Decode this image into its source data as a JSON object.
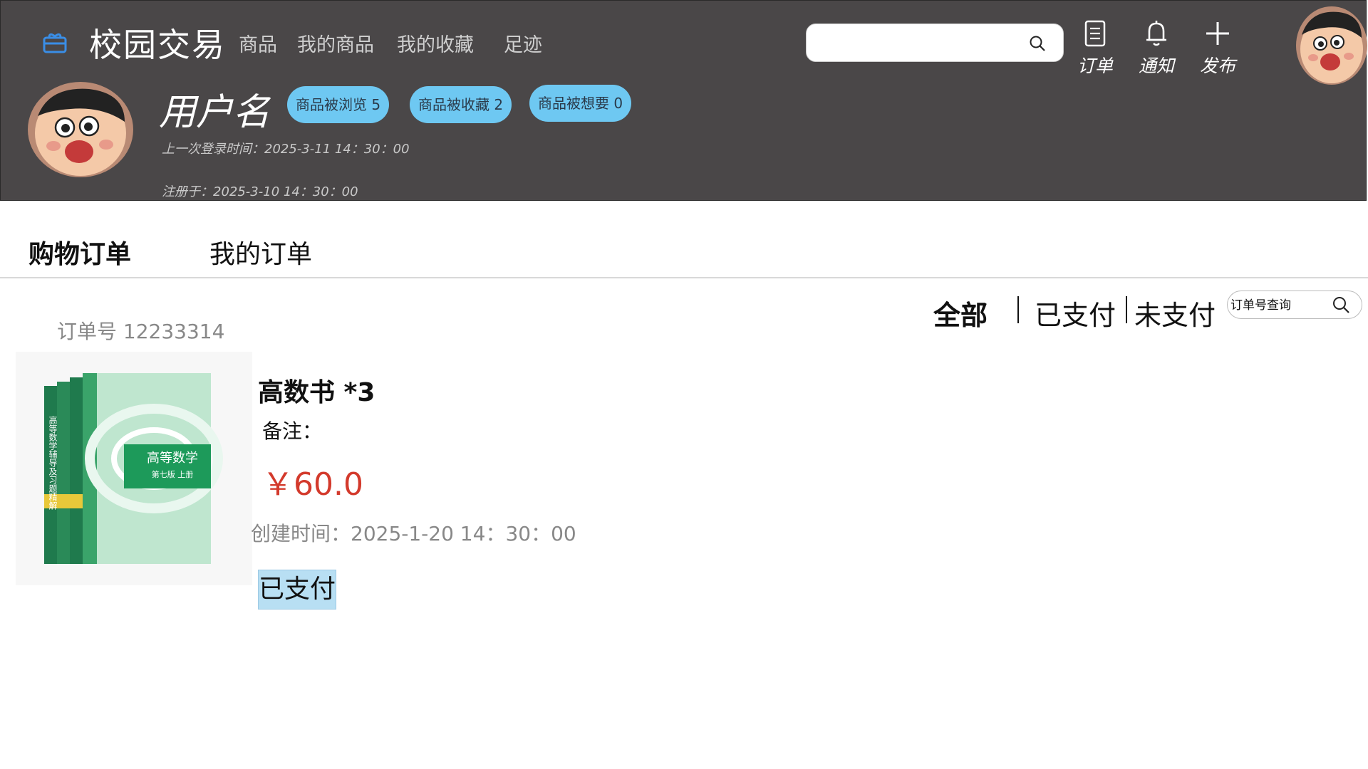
{
  "header": {
    "brand": "校园交易",
    "nav": [
      "商品",
      "我的商品",
      "我的收藏",
      "足迹"
    ],
    "search": {
      "value": "",
      "placeholder": ""
    },
    "actions": {
      "orders": "订单",
      "notify": "通知",
      "publish": "发布"
    }
  },
  "profile": {
    "username": "用户名",
    "badges": [
      "商品被浏览 5",
      "商品被收藏 2",
      "商品被想要 0"
    ],
    "last_login": "上一次登录时间：2025-3-11  14：30：00",
    "registered": "注册于：2025-3-10 14：30：00"
  },
  "tabs": [
    "购物订单",
    "我的订单"
  ],
  "filters": {
    "items": [
      "全部",
      "已支付",
      "未支付"
    ],
    "search_placeholder": "订单号查询"
  },
  "order": {
    "number": "订单号 12233314",
    "product_name": "高数书 *3",
    "remark": "备注：",
    "price": "￥60.0",
    "created": "创建时间：2025-1-20 14：30：00",
    "status": "已支付",
    "book_cover_title": "高等数学",
    "book_cover_edition": "第七版  上册",
    "book_spine_title": "高等数学辅导及习题精解"
  },
  "colors": {
    "header_bg": "#4a4748",
    "badge_bg": "#6ec8f2",
    "price": "#d33a2c",
    "status_bg": "#b8dff3",
    "logo": "#3a8ee6"
  }
}
